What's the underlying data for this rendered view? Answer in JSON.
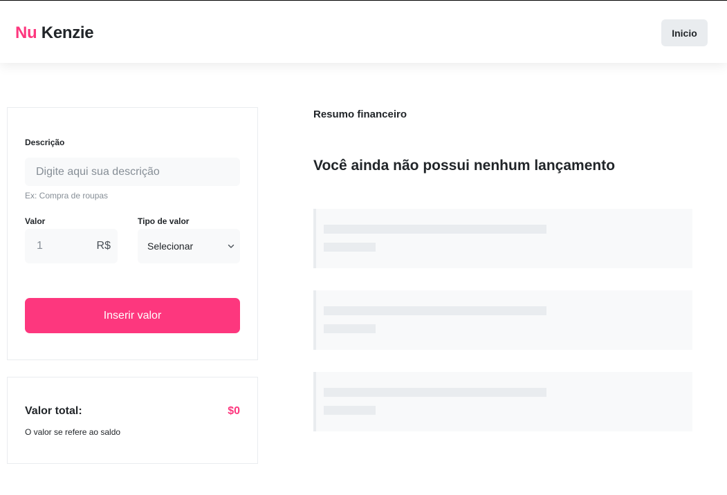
{
  "header": {
    "logo_part1": "Nu",
    "logo_part2": "Kenzie",
    "home_button": "Inicio"
  },
  "form": {
    "description_label": "Descrição",
    "description_placeholder": "Digite aqui sua descrição",
    "description_hint": "Ex: Compra de roupas",
    "value_label": "Valor",
    "value_placeholder": "1",
    "currency": "R$",
    "type_label": "Tipo de valor",
    "type_selected": "Selecionar",
    "submit_button": "Inserir valor"
  },
  "total": {
    "label": "Valor total:",
    "value": "$0",
    "subtitle": "O valor se refere ao saldo"
  },
  "summary": {
    "title": "Resumo financeiro",
    "empty_message": "Você ainda não possui nenhum lançamento"
  },
  "colors": {
    "brand": "#fd377e",
    "text": "#212529",
    "muted": "#868e96",
    "surface": "#f8f9fa",
    "skeleton": "#e9ecef"
  }
}
